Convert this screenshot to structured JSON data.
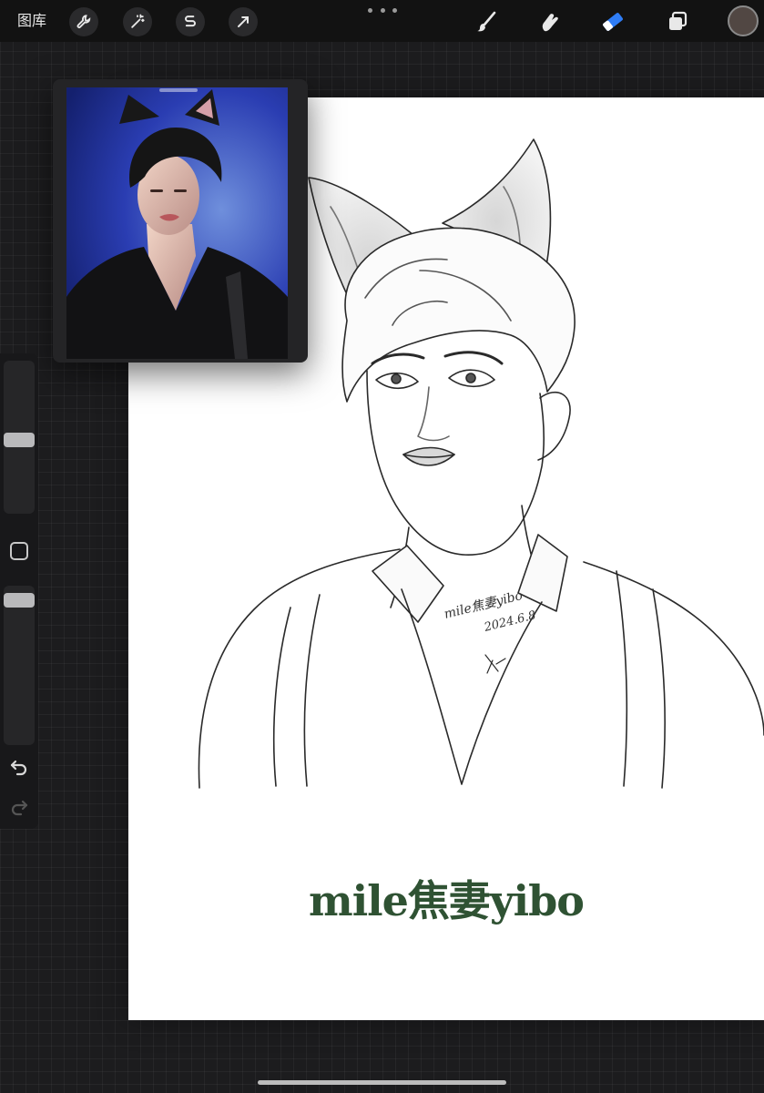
{
  "toolbar": {
    "gallery_label": "图库",
    "left_tools": [
      "wrench-icon",
      "magic-wand-icon",
      "selection-icon",
      "transform-arrow-icon"
    ],
    "right_tools": [
      "brush-icon",
      "smudge-icon",
      "eraser-icon",
      "layers-icon"
    ],
    "active_tool": "eraser",
    "active_color": "#514743",
    "accent_color": "#2f7df6"
  },
  "canvas": {
    "caption": "mile焦妻yibo",
    "caption_color": "#2f5233",
    "signature_line_1": "mile焦妻yibo",
    "signature_line_2": "2024.6.8"
  },
  "reference": {
    "label": "reference image"
  },
  "sidebar": {
    "brush_size_level": 0.48,
    "opacity_level": 0.05
  }
}
